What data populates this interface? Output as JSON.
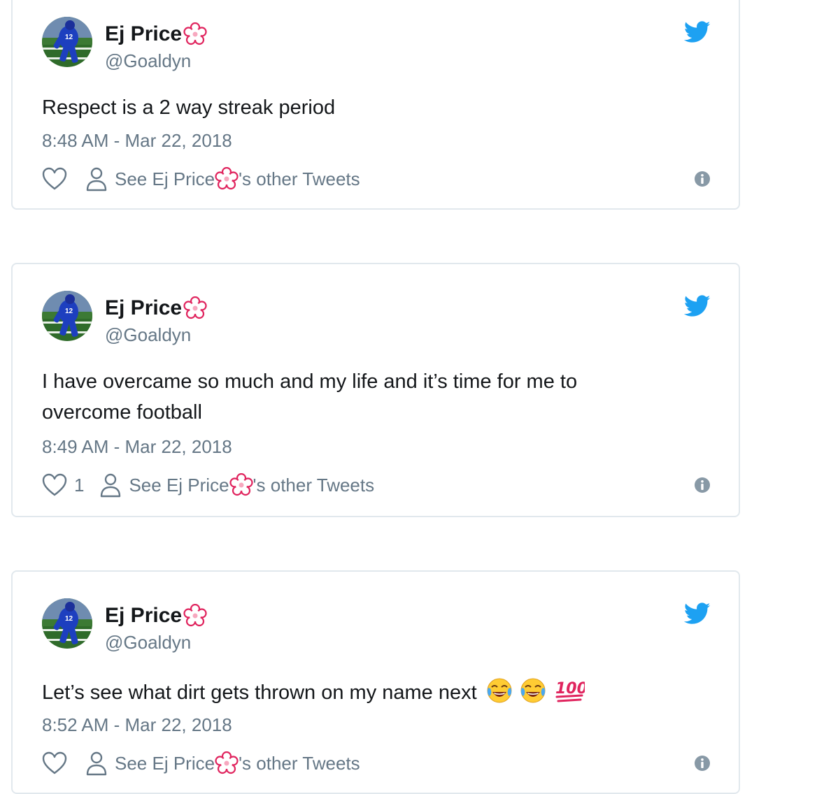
{
  "tweets": [
    {
      "author_name": "Ej Price",
      "handle": "@Goaldyn",
      "text": "Respect is a 2 way streak period",
      "timestamp": "8:48 AM - Mar 22, 2018",
      "like_count": "",
      "link_prefix": "See Ej Price",
      "link_suffix": "'s other Tweets"
    },
    {
      "author_name": "Ej Price",
      "handle": "@Goaldyn",
      "text": "I have overcame so much and my life and it’s time for me to overcome football",
      "timestamp": "8:49 AM - Mar 22, 2018",
      "like_count": "1",
      "link_prefix": "See Ej Price",
      "link_suffix": "'s other Tweets"
    },
    {
      "author_name": "Ej Price",
      "handle": "@Goaldyn",
      "text": "Let’s see what dirt gets thrown on my name next",
      "emojis": [
        "face-with-tears-of-joy",
        "face-with-tears-of-joy",
        "hundred-points"
      ],
      "timestamp": "8:52 AM - Mar 22, 2018",
      "like_count": "",
      "link_prefix": "See Ej Price",
      "link_suffix": "'s other Tweets"
    }
  ],
  "icons": {
    "brand": "twitter-bird-icon",
    "like": "heart-icon",
    "profile": "person-icon",
    "info": "info-icon",
    "name_decoration": "flower-icon"
  },
  "colors": {
    "twitter_blue": "#1da1f2",
    "text_primary": "#14171a",
    "text_secondary": "#657786",
    "border": "#e1e8ed",
    "flower": "#e0245e"
  }
}
